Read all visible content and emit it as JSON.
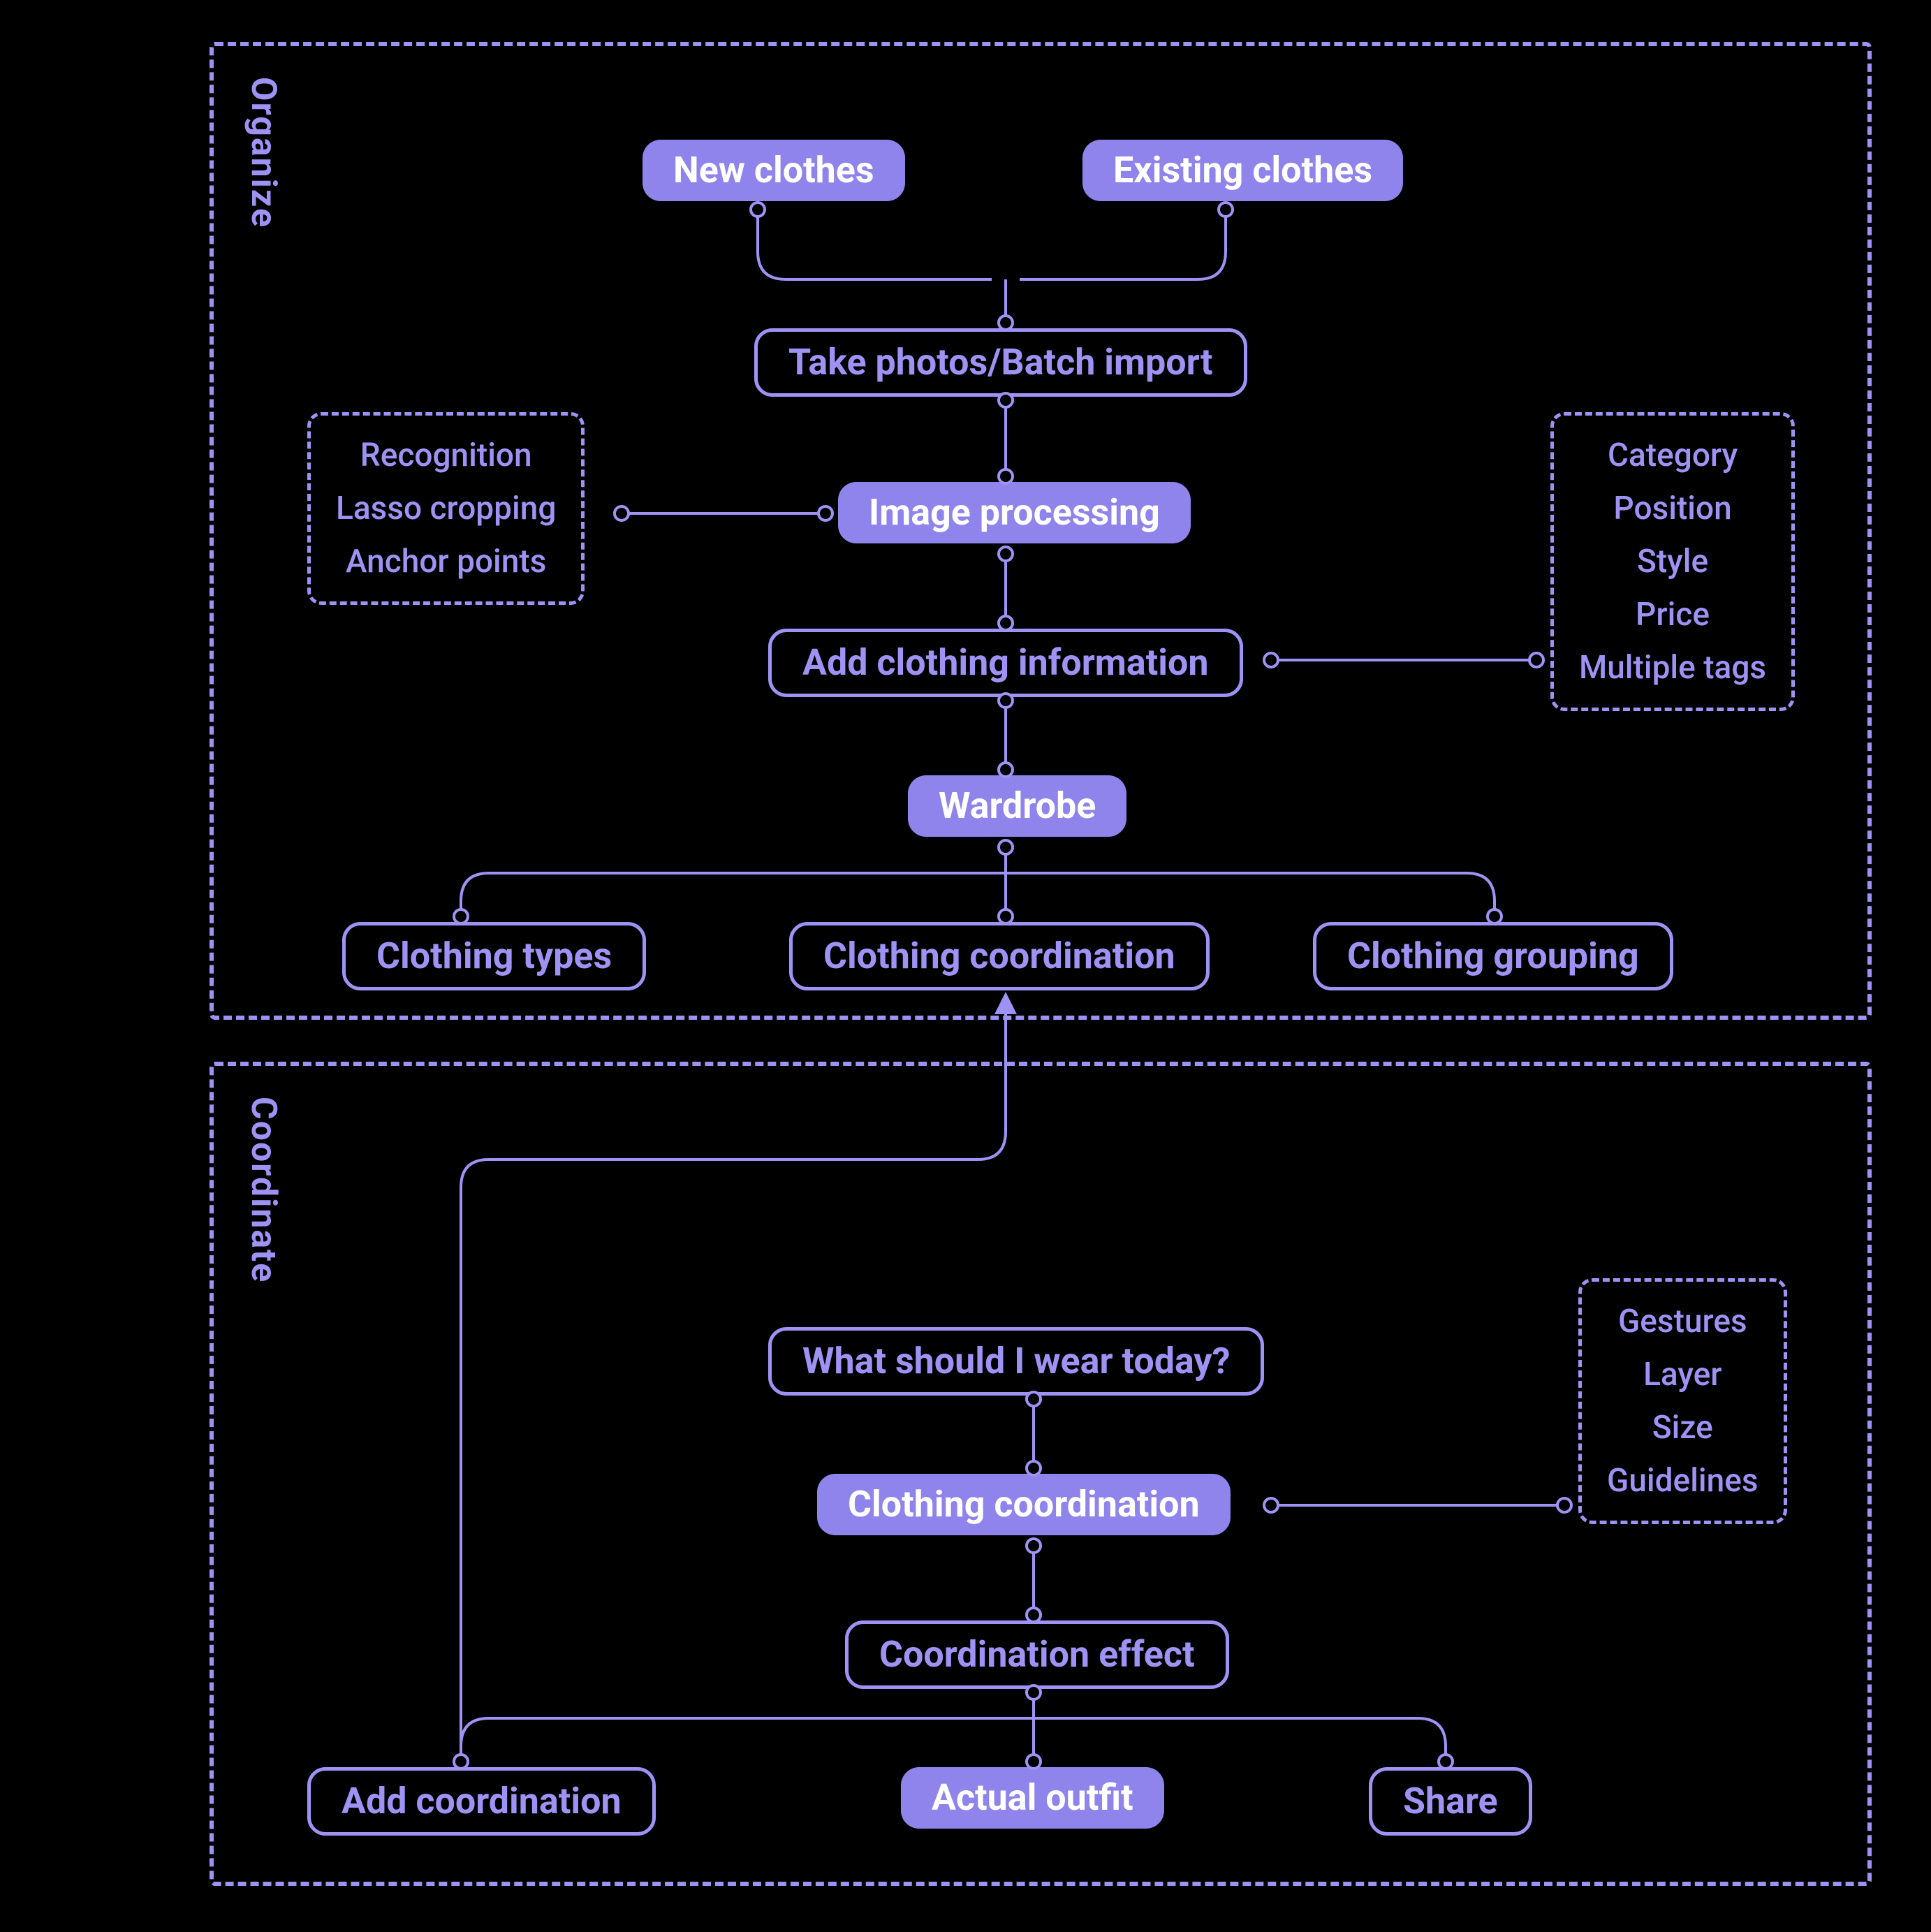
{
  "sections": {
    "organize": {
      "label": "Organize"
    },
    "coordinate": {
      "label": "Coordinate"
    }
  },
  "nodes": {
    "new_clothes": {
      "text": "New clothes"
    },
    "existing_clothes": {
      "text": "Existing clothes"
    },
    "take_photos": {
      "text": "Take photos/Batch import"
    },
    "image_processing": {
      "text": "Image processing"
    },
    "add_info": {
      "text": "Add clothing information"
    },
    "wardrobe": {
      "text": "Wardrobe"
    },
    "clothing_types": {
      "text": "Clothing types"
    },
    "clothing_coord": {
      "text": "Clothing coordination"
    },
    "clothing_grouping": {
      "text": "Clothing grouping"
    },
    "what_wear": {
      "text": "What should I wear today?"
    },
    "clothing_coord2": {
      "text": "Clothing coordination"
    },
    "coord_effect": {
      "text": "Coordination effect"
    },
    "add_coord": {
      "text": "Add coordination"
    },
    "actual_outfit": {
      "text": "Actual outfit"
    },
    "share": {
      "text": "Share"
    }
  },
  "attrs": {
    "processing": [
      "Recognition",
      "Lasso cropping",
      "Anchor points"
    ],
    "info": [
      "Category",
      "Position",
      "Style",
      "Price",
      "Multiple tags"
    ],
    "coord": [
      "Gestures",
      "Layer",
      "Size",
      "Guidelines"
    ]
  },
  "palette": {
    "accent": "#9e93f5",
    "fill": "#8e84ec",
    "bg": "#000000"
  }
}
